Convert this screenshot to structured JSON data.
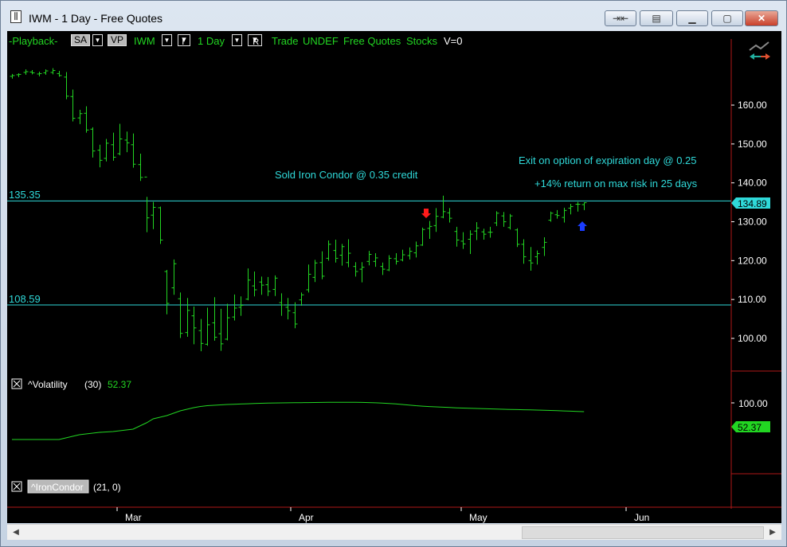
{
  "window": {
    "title": "IWM - 1 Day - Free Quotes",
    "icon": "chart-bars-icon",
    "buttons": [
      "restore-icon",
      "notes-icon",
      "minimize-icon",
      "maximize-icon",
      "close-icon"
    ]
  },
  "toolbar": {
    "playback": "-Playback-",
    "sa": "SA",
    "vp": "VP",
    "symbol": "IWM",
    "interval_box": "I",
    "interval": "1 Day",
    "range_box": "R",
    "trade": "Trade",
    "undef": "UNDEF",
    "feed": "Free Quotes",
    "type": "Stocks",
    "volume": "V=0"
  },
  "colors": {
    "bars": "#22d622",
    "cyan": "#2fd9d9",
    "sell_arrow": "#ff1a1a",
    "buy_arrow": "#1a3cff",
    "panel_border": "#b01818"
  },
  "annotations": {
    "upper_level": "135.35",
    "lower_level": "108.59",
    "entry_note": "Sold Iron Condor @ 0.35 credit",
    "exit_note": "Exit on option of expiration day @ 0.25",
    "return_note": "+14% return on max risk in 25 days"
  },
  "indicators": {
    "volatility": {
      "name": "^Volatility",
      "param": "(30)",
      "value": "52.37"
    },
    "iron_condor": {
      "name": "^IronCondor",
      "param": "(21,  0)"
    }
  },
  "chart_data": {
    "type": "bar",
    "title": "IWM - 1 Day",
    "price_axis": {
      "ticks": [
        "160.00",
        "150.00",
        "140.00",
        "130.00",
        "120.00",
        "110.00",
        "100.00"
      ],
      "ylim": [
        96,
        170
      ]
    },
    "last_price_label": "134.89",
    "x_labels": [
      "Mar",
      "Apr",
      "May",
      "Jun"
    ],
    "ohlc": [
      [
        167.4,
        168.0,
        166.8,
        167.6
      ],
      [
        167.8,
        168.2,
        167.2,
        167.9
      ],
      [
        168.4,
        169.2,
        167.8,
        168.6
      ],
      [
        168.5,
        169.0,
        167.9,
        168.3
      ],
      [
        168.0,
        168.6,
        167.4,
        168.1
      ],
      [
        168.3,
        169.2,
        167.8,
        168.8
      ],
      [
        168.4,
        169.5,
        167.9,
        168.9
      ],
      [
        168.1,
        168.8,
        167.3,
        167.6
      ],
      [
        167.2,
        168.5,
        161.5,
        162.3
      ],
      [
        162.2,
        164.0,
        155.8,
        156.6
      ],
      [
        156.7,
        158.8,
        155.1,
        157.8
      ],
      [
        157.9,
        159.7,
        152.9,
        153.6
      ],
      [
        153.8,
        154.3,
        146.5,
        148.2
      ],
      [
        148.4,
        149.8,
        144.0,
        145.8
      ],
      [
        146.3,
        151.3,
        145.5,
        150.2
      ],
      [
        149.8,
        152.9,
        145.7,
        146.6
      ],
      [
        147.5,
        155.2,
        147.1,
        151.3
      ],
      [
        151.0,
        153.2,
        147.9,
        150.3
      ],
      [
        149.8,
        152.7,
        143.9,
        144.8
      ],
      [
        144.7,
        147.5,
        140.5,
        141.4
      ],
      [
        141.5,
        136.4,
        127.3,
        131.0
      ],
      [
        131.7,
        135.1,
        128.1,
        133.7
      ],
      [
        133.6,
        133.9,
        124.3,
        125.3
      ],
      [
        117.2,
        117.6,
        106.2,
        109.0
      ],
      [
        113.0,
        120.3,
        111.2,
        119.2
      ],
      [
        110.2,
        111.8,
        100.1,
        101.3
      ],
      [
        101.5,
        110.4,
        100.4,
        107.2
      ],
      [
        105.8,
        108.2,
        98.5,
        102.7
      ],
      [
        102.0,
        105.0,
        96.7,
        98.7
      ],
      [
        98.5,
        107.9,
        98.1,
        103.5
      ],
      [
        104.0,
        110.6,
        99.4,
        100.3
      ],
      [
        101.2,
        107.6,
        96.8,
        98.6
      ],
      [
        99.8,
        108.9,
        99.5,
        105.3
      ],
      [
        105.5,
        111.3,
        104.6,
        107.8
      ],
      [
        108.0,
        110.8,
        105.8,
        108.5
      ],
      [
        110.1,
        118.0,
        109.8,
        115.0
      ],
      [
        113.5,
        117.2,
        110.8,
        112.5
      ],
      [
        114.5,
        115.9,
        111.2,
        113.7
      ],
      [
        113.8,
        115.8,
        110.9,
        112.1
      ],
      [
        112.6,
        116.2,
        110.9,
        115.5
      ],
      [
        109.2,
        111.6,
        105.8,
        108.6
      ],
      [
        108.0,
        110.4,
        104.9,
        107.1
      ],
      [
        106.6,
        109.3,
        102.6,
        103.7
      ],
      [
        109.9,
        111.8,
        108.4,
        111.2
      ],
      [
        112.5,
        119.0,
        111.8,
        116.5
      ],
      [
        115.7,
        120.2,
        114.5,
        119.4
      ],
      [
        119.5,
        122.4,
        115.2,
        116.0
      ],
      [
        120.6,
        125.2,
        120.0,
        124.2
      ],
      [
        122.6,
        125.4,
        119.5,
        120.6
      ],
      [
        121.4,
        124.3,
        118.7,
        123.6
      ],
      [
        119.5,
        125.5,
        118.3,
        121.9
      ],
      [
        118.5,
        119.6,
        115.9,
        117.2
      ],
      [
        117.8,
        119.6,
        114.4,
        118.3
      ],
      [
        119.8,
        122.5,
        118.8,
        121.6
      ],
      [
        119.8,
        121.9,
        118.4,
        120.7
      ],
      [
        118.5,
        119.5,
        116.3,
        117.8
      ],
      [
        117.6,
        121.4,
        117.3,
        120.6
      ],
      [
        120.5,
        121.9,
        119.0,
        119.8
      ],
      [
        120.2,
        122.8,
        119.8,
        121.5
      ],
      [
        121.3,
        123.4,
        120.3,
        122.4
      ],
      [
        122.0,
        124.9,
        120.8,
        123.8
      ],
      [
        124.0,
        128.5,
        123.8,
        128.0
      ],
      [
        128.3,
        130.2,
        125.6,
        128.8
      ],
      [
        129.0,
        133.5,
        127.4,
        131.4
      ],
      [
        131.2,
        136.7,
        130.9,
        132.6
      ],
      [
        132.3,
        133.5,
        129.8,
        130.9
      ],
      [
        127.5,
        128.7,
        123.6,
        125.3
      ],
      [
        125.0,
        127.3,
        123.0,
        124.3
      ],
      [
        125.5,
        127.8,
        121.7,
        126.8
      ],
      [
        127.6,
        129.9,
        125.3,
        128.4
      ],
      [
        127.4,
        128.2,
        125.4,
        126.8
      ],
      [
        127.3,
        128.7,
        125.9,
        127.3
      ],
      [
        129.7,
        132.7,
        128.9,
        132.2
      ],
      [
        131.5,
        132.5,
        128.7,
        130.0
      ],
      [
        128.5,
        132.0,
        128.0,
        131.5
      ],
      [
        127.9,
        128.3,
        123.5,
        124.2
      ],
      [
        124.2,
        125.5,
        119.2,
        121.0
      ],
      [
        120.0,
        123.5,
        117.4,
        119.4
      ],
      [
        121.0,
        122.6,
        119.0,
        121.8
      ],
      [
        123.4,
        126.0,
        121.2,
        124.7
      ],
      [
        130.4,
        132.6,
        130.0,
        132.2
      ],
      [
        131.8,
        133.0,
        130.8,
        131.6
      ],
      [
        131.1,
        133.6,
        129.8,
        132.9
      ],
      [
        133.5,
        134.6,
        131.9,
        133.9
      ],
      [
        134.5,
        135.1,
        132.6,
        134.5
      ],
      [
        134.4,
        135.0,
        133.0,
        134.9
      ]
    ],
    "volatility_series": [
      54,
      54,
      54,
      54,
      54,
      54,
      54,
      54,
      56,
      58,
      60,
      61,
      62,
      63,
      63.5,
      64,
      65,
      66,
      67,
      71,
      75,
      80,
      82,
      84,
      87,
      90,
      92,
      94,
      95.5,
      96.5,
      97,
      97.5,
      98,
      98.3,
      98.6,
      98.9,
      99.2,
      99.5,
      99.7,
      99.9,
      100,
      100.1,
      100.2,
      100.3,
      100.4,
      100.5,
      100.6,
      100.7,
      100.8,
      100.8,
      100.8,
      100.7,
      100.6,
      100.4,
      100.1,
      99.7,
      99.2,
      98.7,
      98,
      97.3,
      96.5,
      95.9,
      95.4,
      95,
      94.6,
      94.2,
      93.8,
      93.5,
      93.2,
      93,
      92.7,
      92.5,
      92.2,
      92,
      91.8,
      91.6,
      91.4,
      91.2,
      91,
      90.8,
      90.5,
      90.2,
      89.9,
      89.6,
      89.3,
      89
    ],
    "volatility_axis": {
      "ticks": [
        "100.00"
      ],
      "value_label": "52.37"
    },
    "levels": [
      135.35,
      108.59
    ]
  }
}
